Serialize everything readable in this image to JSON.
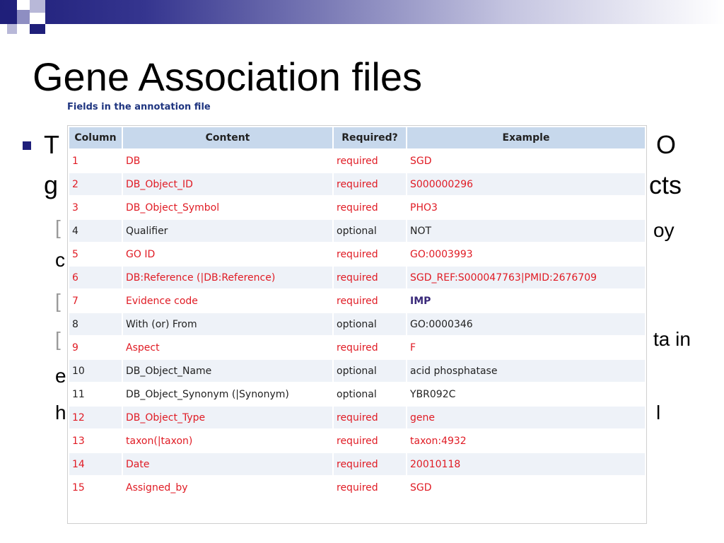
{
  "slide": {
    "title": "Gene Association files"
  },
  "background_fragments": [
    "T",
    "O",
    "g",
    "cts",
    "[",
    "oy",
    "c",
    "[",
    "[",
    "ta in",
    "e",
    "h",
    "l"
  ],
  "table": {
    "caption": "Fields in the annotation file",
    "headers": [
      "Column",
      "Content",
      "Required?",
      "Example"
    ],
    "rows": [
      {
        "col": "1",
        "content": "DB",
        "required": "required",
        "example": "SGD"
      },
      {
        "col": "2",
        "content": "DB_Object_ID",
        "required": "required",
        "example": "S000000296"
      },
      {
        "col": "3",
        "content": "DB_Object_Symbol",
        "required": "required",
        "example": "PHO3"
      },
      {
        "col": "4",
        "content": "Qualifier",
        "required": "optional",
        "example": "NOT"
      },
      {
        "col": "5",
        "content": "GO ID",
        "required": "required",
        "example": "GO:0003993"
      },
      {
        "col": "6",
        "content": "DB:Reference (|DB:Reference)",
        "required": "required",
        "example": "SGD_REF:S000047763|PMID:2676709"
      },
      {
        "col": "7",
        "content": "Evidence code",
        "required": "required",
        "example": "IMP"
      },
      {
        "col": "8",
        "content": "With (or) From",
        "required": "optional",
        "example": "GO:0000346"
      },
      {
        "col": "9",
        "content": "Aspect",
        "required": "required",
        "example": "F"
      },
      {
        "col": "10",
        "content": "DB_Object_Name",
        "required": "optional",
        "example": "acid phosphatase"
      },
      {
        "col": "11",
        "content": "DB_Object_Synonym (|Synonym)",
        "required": "optional",
        "example": "YBR092C"
      },
      {
        "col": "12",
        "content": "DB_Object_Type",
        "required": "required",
        "example": "gene"
      },
      {
        "col": "13",
        "content": "taxon(|taxon)",
        "required": "required",
        "example": "taxon:4932"
      },
      {
        "col": "14",
        "content": "Date",
        "required": "required",
        "example": "20010118"
      },
      {
        "col": "15",
        "content": "Assigned_by",
        "required": "required",
        "example": "SGD"
      }
    ]
  },
  "colors": {
    "required_text": "#e01b24",
    "header_bg": "#c7d8ec",
    "row_alt_bg": "#eef2f8",
    "title_band": "#1f1f7a"
  }
}
